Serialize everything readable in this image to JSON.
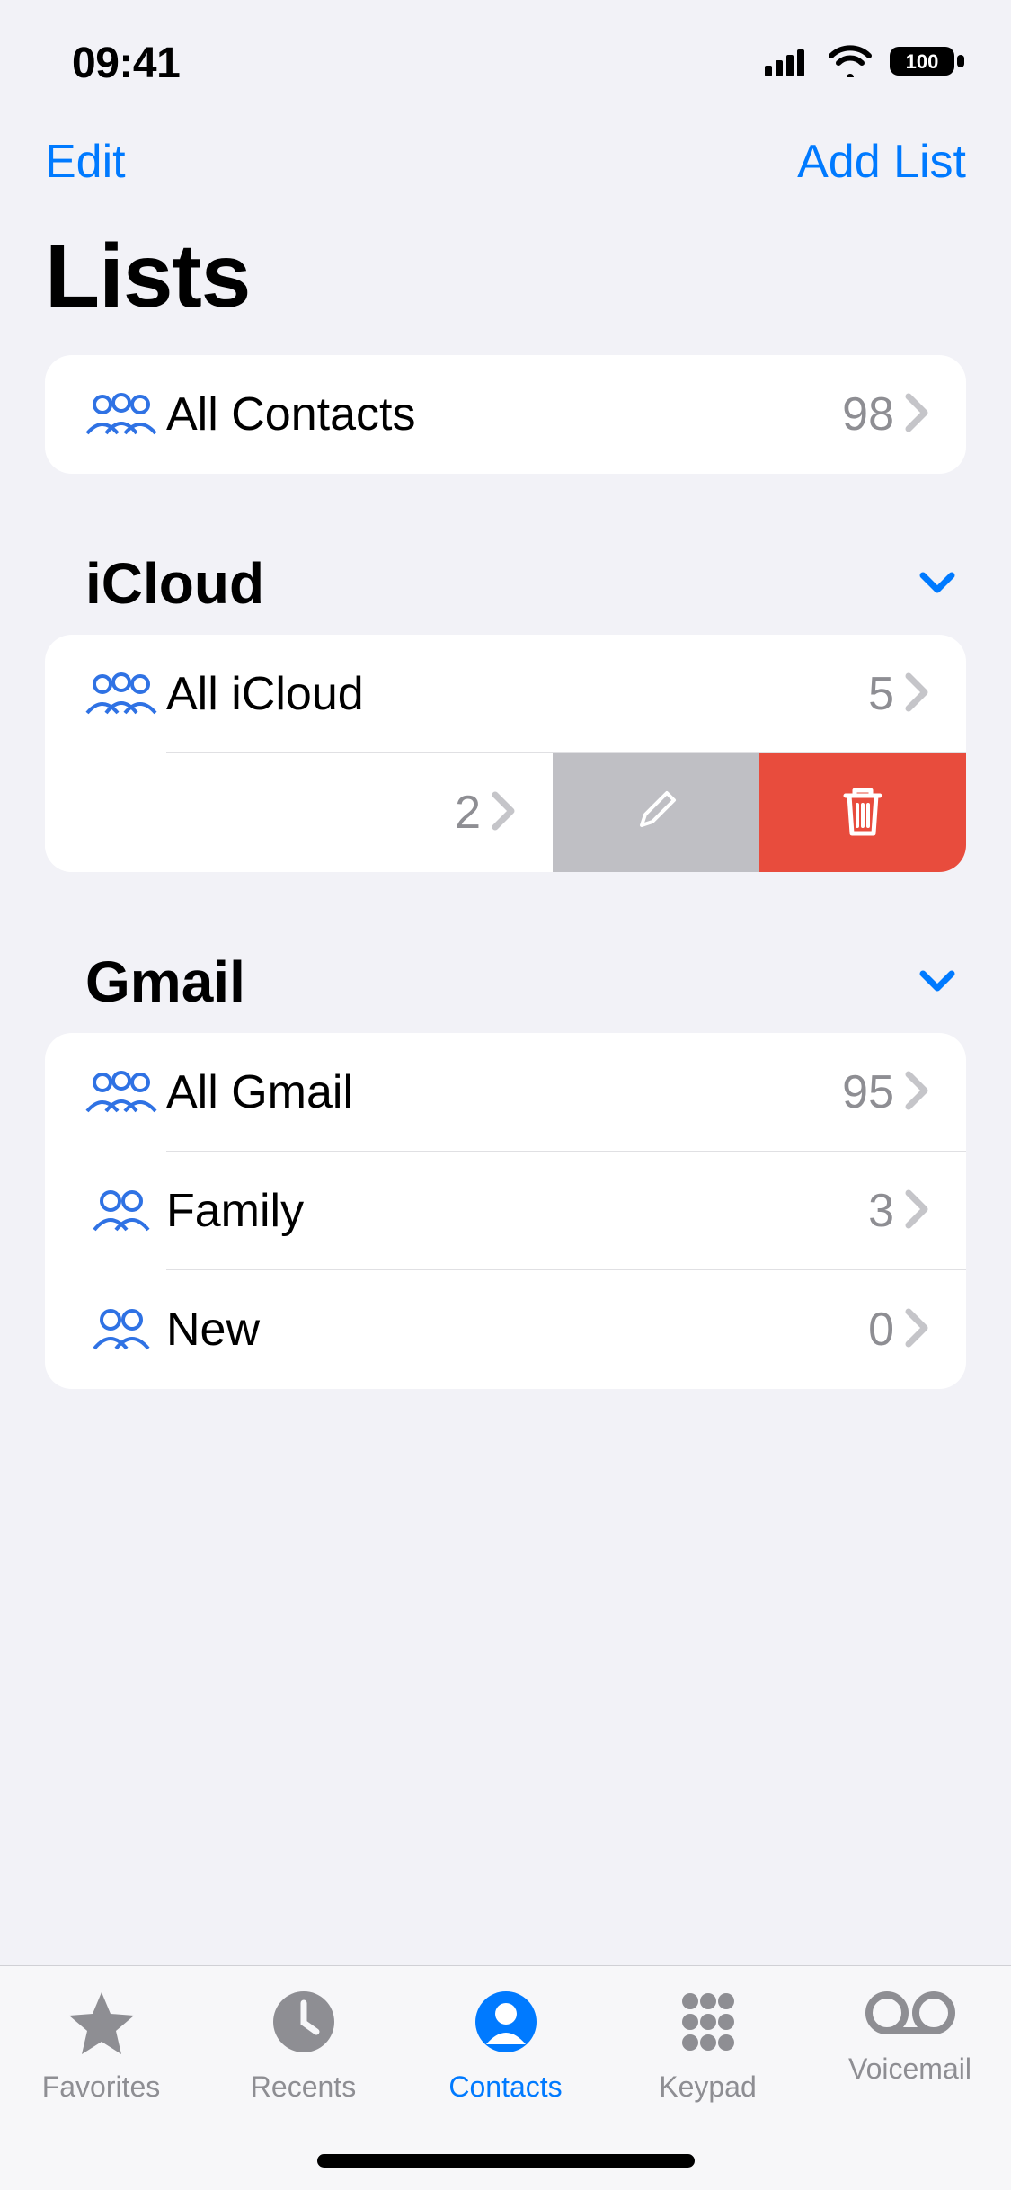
{
  "status": {
    "time": "09:41",
    "battery": "100"
  },
  "nav": {
    "edit": "Edit",
    "addList": "Add List"
  },
  "title": "Lists",
  "allContacts": {
    "label": "All Contacts",
    "count": "98"
  },
  "sections": {
    "icloud": {
      "title": "iCloud",
      "allRow": {
        "label": "All iCloud",
        "count": "5"
      },
      "swipedRow": {
        "count": "2"
      }
    },
    "gmail": {
      "title": "Gmail",
      "rows": [
        {
          "label": "All Gmail",
          "count": "95"
        },
        {
          "label": "Family",
          "count": "3"
        },
        {
          "label": "New",
          "count": "0"
        }
      ]
    }
  },
  "tabs": {
    "favorites": "Favorites",
    "recents": "Recents",
    "contacts": "Contacts",
    "keypad": "Keypad",
    "voicemail": "Voicemail"
  }
}
